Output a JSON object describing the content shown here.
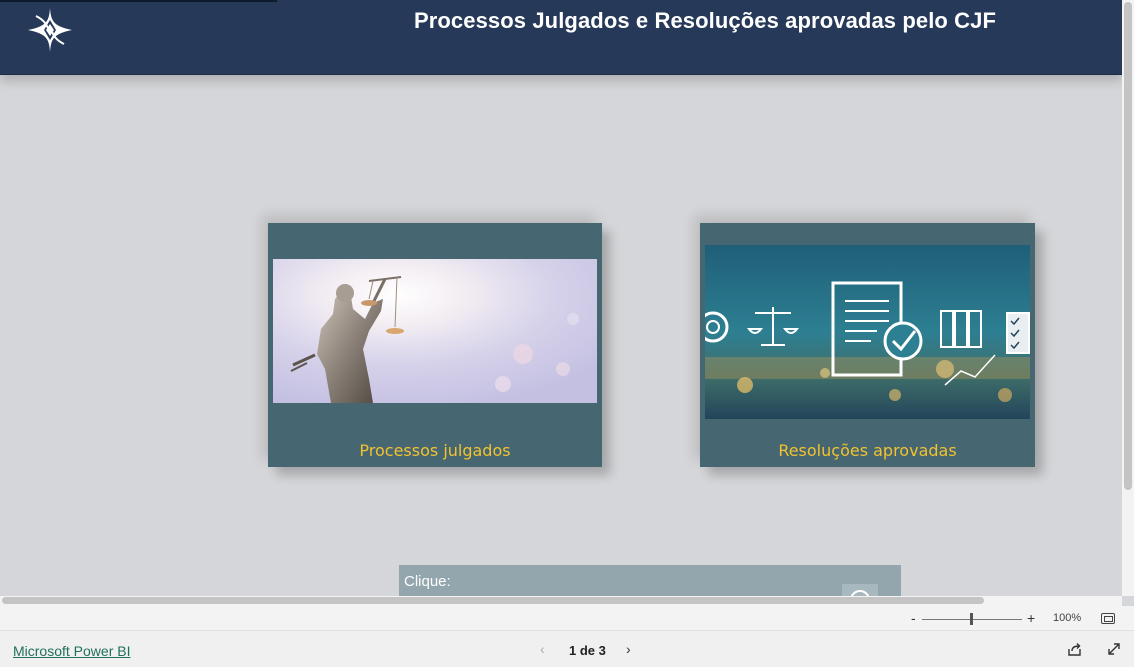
{
  "header": {
    "title": "Processos Julgados e Resoluções aprovadas pelo CJF",
    "logo_icon": "cjf-star-logo-icon"
  },
  "cards": [
    {
      "label": "Processos julgados",
      "image_icon": "lady-justice-statue-image"
    },
    {
      "label": "Resoluções aprovadas",
      "image_icon": "digital-law-document-image"
    }
  ],
  "click_panel": {
    "label": "Clique:"
  },
  "zoom": {
    "minus": "-",
    "plus": "+",
    "value": "100%",
    "level": 0.5
  },
  "footer": {
    "brand_link": "Microsoft Power BI",
    "page_indicator": "1 de 3",
    "prev": "‹",
    "next": "›"
  },
  "colors": {
    "header_bg": "#263959",
    "card_bg": "#466771",
    "card_label": "#f2c230",
    "canvas_bg": "#d5d6d9"
  }
}
